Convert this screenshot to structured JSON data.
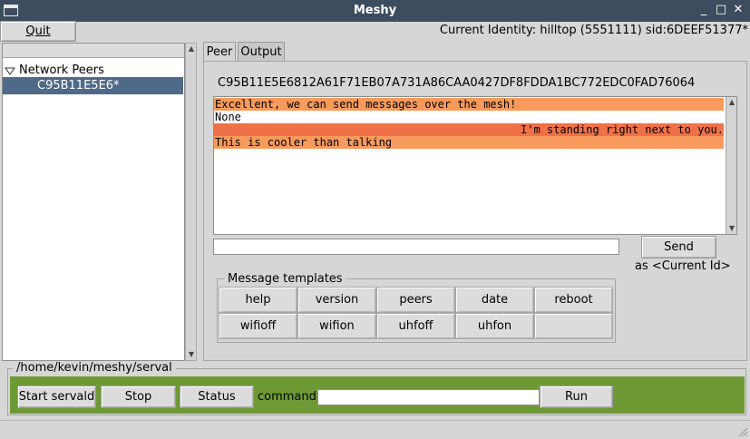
{
  "window": {
    "title": "Meshy",
    "controls": [
      "_",
      "□",
      "✕"
    ]
  },
  "menu": {
    "quit_label": "Quit"
  },
  "identity": {
    "text": "Current Identity: hilltop (5551111) sid:6DEEF51377*"
  },
  "tree": {
    "root_label": "Network Peers",
    "items": [
      {
        "label": "C95B11E5E6*",
        "selected": true
      }
    ]
  },
  "tabs": [
    {
      "label": "Peer",
      "active": true
    },
    {
      "label": "Output",
      "active": false
    }
  ],
  "peer": {
    "sid": "C95B11E5E6812A61F71EB07A731A86CAA0427DF8FDDA1BC772EDC0FAD76064",
    "messages": [
      {
        "text": "Excellent, we can send messages over the mesh!",
        "align": "left",
        "color": "#f79a5b"
      },
      {
        "text": "None",
        "align": "left",
        "color": "#ffffff"
      },
      {
        "text": "I'm standing right next to you.",
        "align": "right",
        "color": "#f07148"
      },
      {
        "text": "This is cooler than talking",
        "align": "left",
        "color": "#f79a5b"
      }
    ],
    "input_value": "",
    "send_label": "Send",
    "send_as": "as <Current Id>"
  },
  "templates": {
    "label": "Message templates",
    "buttons": [
      "help",
      "version",
      "peers",
      "date",
      "reboot",
      "wifioff",
      "wifion",
      "uhfoff",
      "uhfon",
      ""
    ]
  },
  "servald": {
    "path": "/home/kevin/meshy/serval",
    "start_label": "Start servald",
    "stop_label": "Stop",
    "status_label": "Status",
    "command_label": "command:",
    "command_value": "",
    "run_label": "Run",
    "panel_color": "#6e9a35"
  }
}
